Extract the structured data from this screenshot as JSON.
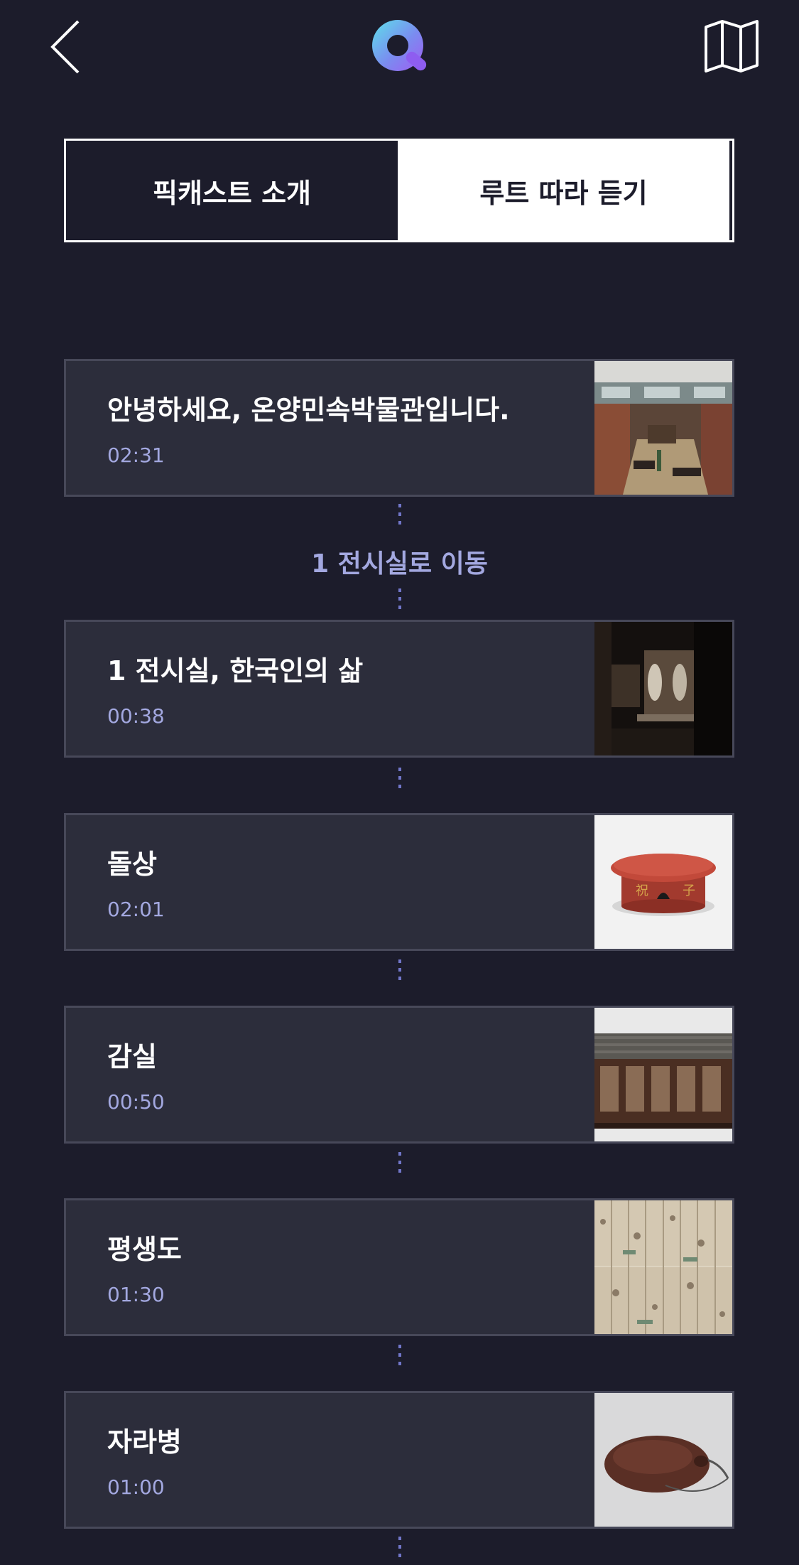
{
  "header": {
    "back_icon": "chevron-left-icon",
    "logo_icon": "q-logo",
    "map_icon": "map-icon"
  },
  "tabs": [
    {
      "label": "픽캐스트 소개",
      "selected": false
    },
    {
      "label": "루트 따라 듣기",
      "selected": true
    }
  ],
  "route": {
    "move_label": "1 전시실로 이동",
    "items": [
      {
        "title": "안녕하세요, 온양민속박물관입니다.",
        "duration": "02:31",
        "thumb": "museum-lobby"
      },
      {
        "title": "1 전시실, 한국인의 삶",
        "duration": "00:38",
        "thumb": "dark-exhibit-hall"
      },
      {
        "title": "돌상",
        "duration": "02:01",
        "thumb": "red-round-table"
      },
      {
        "title": "감실",
        "duration": "00:50",
        "thumb": "wooden-shrine"
      },
      {
        "title": "평생도",
        "duration": "01:30",
        "thumb": "folding-screen-painting"
      },
      {
        "title": "자라병",
        "duration": "01:00",
        "thumb": "turtle-bottle"
      }
    ]
  },
  "colors": {
    "background": "#1c1c2b",
    "card": "#2c2d3b",
    "accent": "#a3a8e0"
  }
}
